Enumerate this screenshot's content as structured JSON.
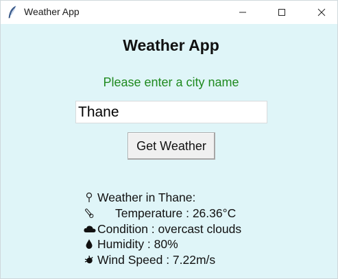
{
  "window": {
    "title": "Weather App",
    "icon": "feather-icon",
    "controls": [
      "minimize-icon",
      "maximize-icon",
      "close-icon"
    ]
  },
  "main": {
    "heading": "Weather App",
    "prompt": "Please enter a city name",
    "city_input_value": "Thane",
    "button_label": "Get Weather"
  },
  "results": {
    "location_line": "Weather in Thane:",
    "temperature_line": "Temperature : 26.36°C",
    "condition_line": "Condition : overcast clouds",
    "humidity_line": "Humidity : 80%",
    "wind_line": "Wind Speed : 7.22m/s",
    "icons": [
      "pin-icon",
      "thermometer-icon",
      "cloud-icon",
      "droplet-icon",
      "wind-icon"
    ]
  },
  "colors": {
    "background": "#dff5f8",
    "prompt_text": "#1f8a1f",
    "titlebar": "#ffffff"
  }
}
